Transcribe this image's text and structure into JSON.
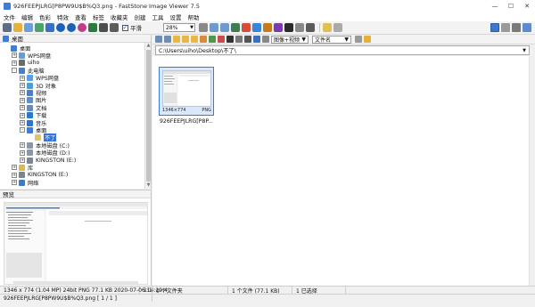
{
  "window": {
    "title": "926FEEPJLRG[P8PW9U$B%Q3.png - FastStone Image Viewer 7.5",
    "minimize": "—",
    "maximize": "☐",
    "close": "✕"
  },
  "menu": [
    "文件",
    "编辑",
    "色彩",
    "特效",
    "查看",
    "标签",
    "收藏夹",
    "创建",
    "工具",
    "设置",
    "帮助"
  ],
  "toolbar": {
    "smooth_label": "平滑",
    "zoom_value": "28%"
  },
  "left_pane": {
    "header": "桌面",
    "tree": [
      {
        "label": "桌面",
        "indent": 0,
        "exp": "",
        "selected": false
      },
      {
        "label": "WPS网盘",
        "indent": 1,
        "exp": "+",
        "selected": false
      },
      {
        "label": "uiho",
        "indent": 1,
        "exp": "+",
        "selected": false
      },
      {
        "label": "此电脑",
        "indent": 1,
        "exp": "-",
        "selected": false
      },
      {
        "label": "WPS网盘",
        "indent": 2,
        "exp": "+",
        "selected": false
      },
      {
        "label": "3D 对象",
        "indent": 2,
        "exp": "+",
        "selected": false
      },
      {
        "label": "视频",
        "indent": 2,
        "exp": "+",
        "selected": false
      },
      {
        "label": "图片",
        "indent": 2,
        "exp": "+",
        "selected": false
      },
      {
        "label": "文档",
        "indent": 2,
        "exp": "+",
        "selected": false
      },
      {
        "label": "下载",
        "indent": 2,
        "exp": "+",
        "selected": false
      },
      {
        "label": "音乐",
        "indent": 2,
        "exp": "+",
        "selected": false
      },
      {
        "label": "桌面",
        "indent": 2,
        "exp": "-",
        "selected": false
      },
      {
        "label": "不了",
        "indent": 3,
        "exp": "",
        "selected": true
      },
      {
        "label": "本地磁盘 (C:)",
        "indent": 2,
        "exp": "+",
        "selected": false
      },
      {
        "label": "本地磁盘 (D:)",
        "indent": 2,
        "exp": "+",
        "selected": false
      },
      {
        "label": "KINGSTON (E:)",
        "indent": 2,
        "exp": "+",
        "selected": false
      },
      {
        "label": "库",
        "indent": 1,
        "exp": "+",
        "selected": false
      },
      {
        "label": "KINGSTON (E:)",
        "indent": 1,
        "exp": "+",
        "selected": false
      },
      {
        "label": "网络",
        "indent": 1,
        "exp": "+",
        "selected": false
      }
    ]
  },
  "preview_pane": {
    "header": "预览"
  },
  "right_pane": {
    "filter": "图像+视频",
    "sort": "文件名",
    "path": "C:\\Users\\uiho\\Desktop\\不了\\",
    "thumbnail": {
      "name": "926FEEPJLRG[P8PW9U$B%Q3.png",
      "short_name": "926FEEPJLRG[P8P...",
      "dimensions": "1346×774",
      "format": "PNG"
    }
  },
  "status": {
    "image_info": "1346 x 774 (1.04 MP)  24bit  PNG  77.1 KB   2020-07-06 14:19:4",
    "image_info_suffix": "1:1",
    "folders": "0 个文件夹",
    "files": "1 个文件 (77.1 KB)",
    "selected": "1 已选择",
    "file_index": "926FEEPJLRG[P8PW9U$B%Q3.png [ 1 / 1 ]"
  }
}
